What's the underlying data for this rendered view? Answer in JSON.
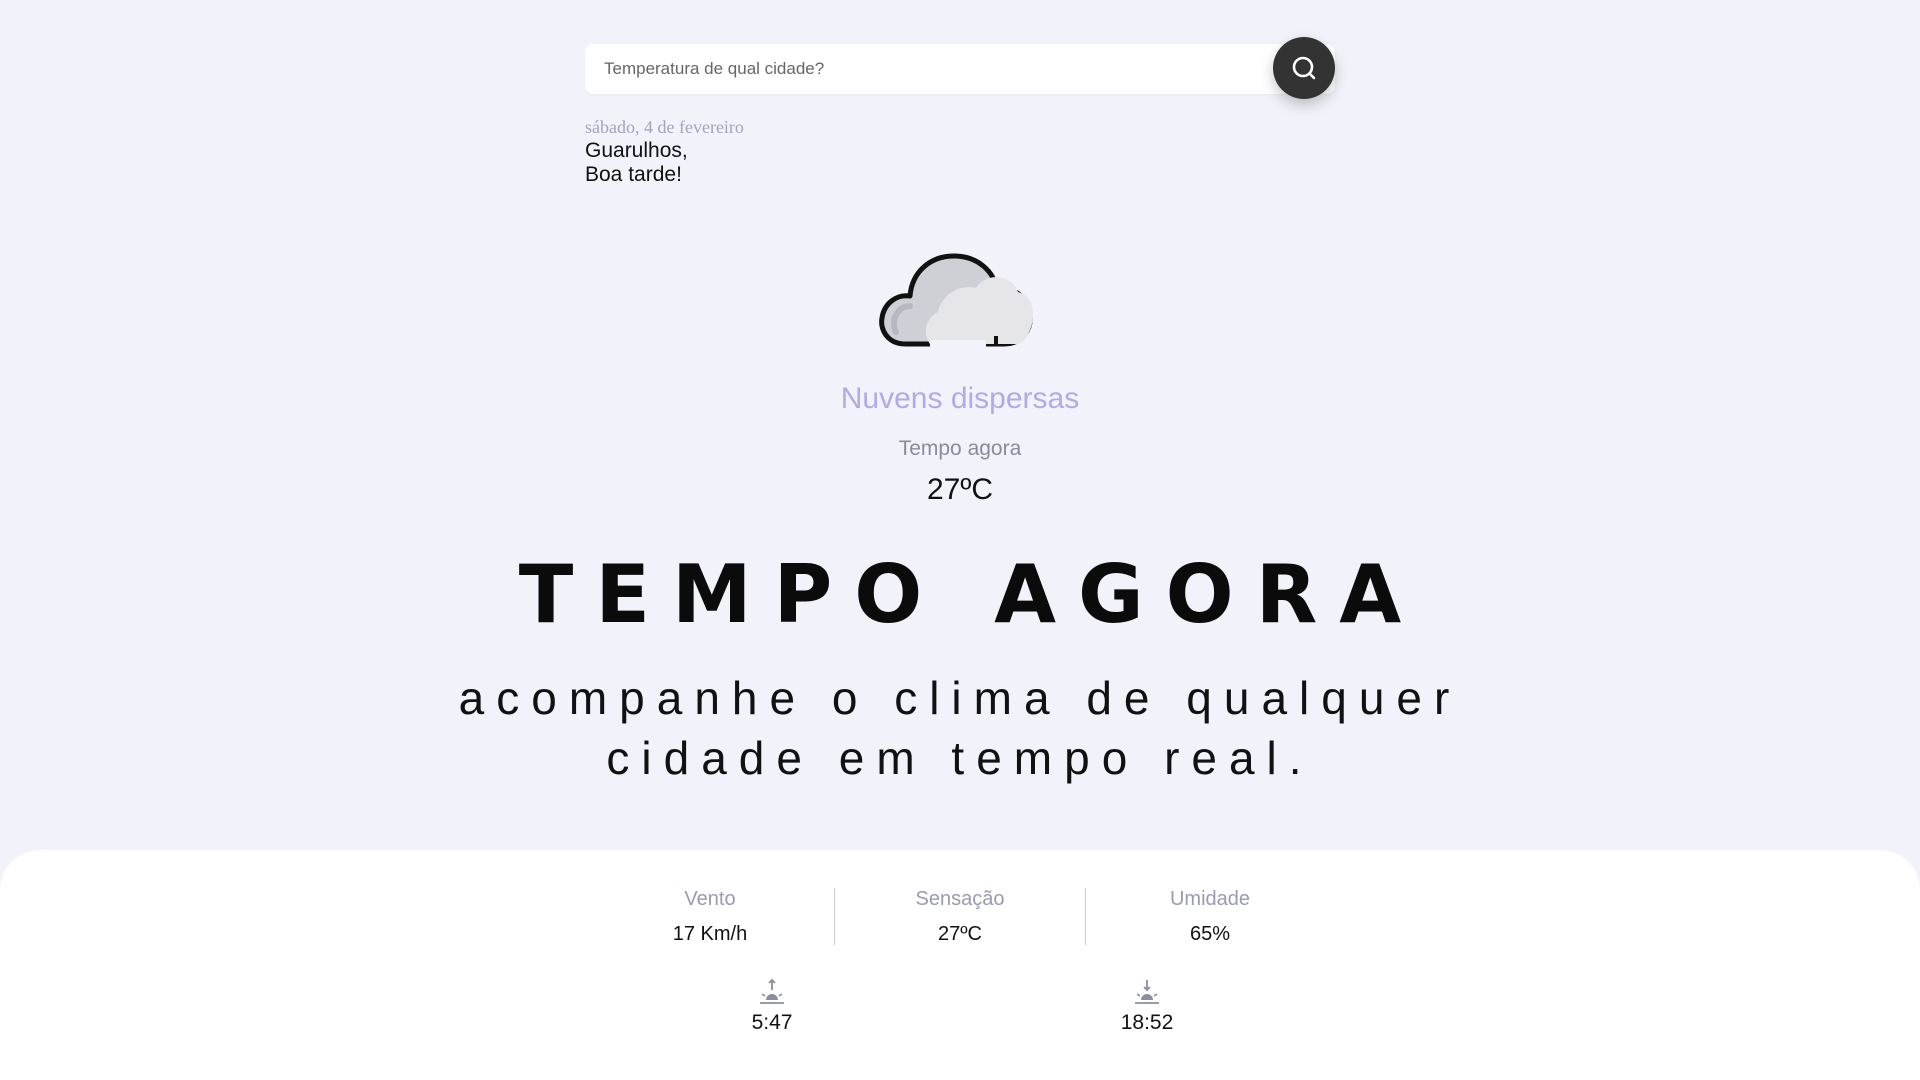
{
  "search": {
    "placeholder": "Temperatura de qual cidade?",
    "button_icon": "search-icon"
  },
  "location": {
    "date": "sábado, 4 de fevereiro",
    "city": "Guarulhos,",
    "greeting": "Boa tarde!"
  },
  "weather": {
    "icon": "cloud-icon",
    "condition": "Nuvens dispersas",
    "now_label": "Tempo agora",
    "temperature": "27ºC"
  },
  "hero": {
    "title": "TEMPO AGORA",
    "subtitle_line1": "acompanhe o clima de qualquer",
    "subtitle_line2": "cidade em tempo real."
  },
  "stats": {
    "wind": {
      "label": "Vento",
      "value": "17 Km/h"
    },
    "feels_like": {
      "label": "Sensação",
      "value": "27ºC"
    },
    "humidity": {
      "label": "Umidade",
      "value": "65%"
    }
  },
  "sun": {
    "sunrise": {
      "icon": "sunrise-icon",
      "time": "5:47"
    },
    "sunset": {
      "icon": "sunset-icon",
      "time": "18:52"
    }
  },
  "colors": {
    "background": "#f2f2fa",
    "accent": "#b3a9e6",
    "muted": "#9a9ab0",
    "button": "#333333",
    "panel": "#ffffff"
  }
}
